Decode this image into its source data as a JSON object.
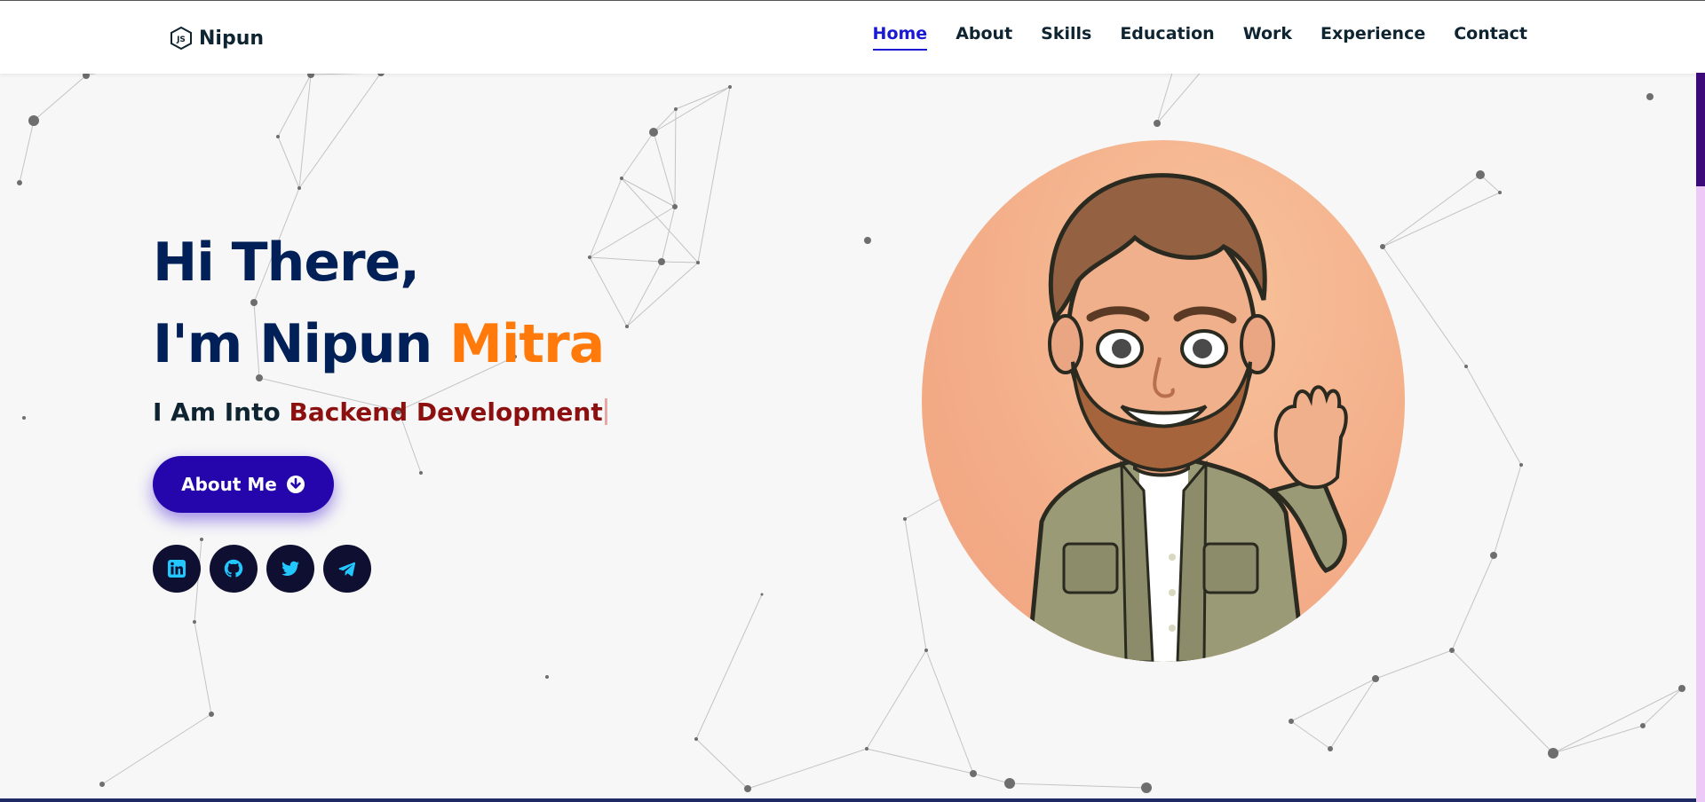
{
  "header": {
    "brand": {
      "name": "Nipun",
      "icon": "nodejs-hex-icon"
    },
    "nav": [
      {
        "label": "Home",
        "active": true
      },
      {
        "label": "About",
        "active": false
      },
      {
        "label": "Skills",
        "active": false
      },
      {
        "label": "Education",
        "active": false
      },
      {
        "label": "Work",
        "active": false
      },
      {
        "label": "Experience",
        "active": false
      },
      {
        "label": "Contact",
        "active": false
      }
    ]
  },
  "hero": {
    "greeting": "Hi There,",
    "name_prefix": "I'm Nipun ",
    "name_accent": "Mitra",
    "typed_prefix": "I Am Into ",
    "typed_value": "Backend Development",
    "about_button": {
      "label": "About Me",
      "icon": "arrow-down-circle-icon"
    },
    "socials": [
      {
        "name": "linkedin",
        "icon": "linkedin-icon"
      },
      {
        "name": "github",
        "icon": "github-icon"
      },
      {
        "name": "twitter",
        "icon": "twitter-icon"
      },
      {
        "name": "telegram",
        "icon": "telegram-icon"
      }
    ],
    "avatar": {
      "icon": "cartoon-avatar-waving"
    }
  },
  "colors": {
    "nav_active": "#1a1ad4",
    "heading": "#002057",
    "accent_orange": "#ff7a0b",
    "typed_accent": "#8d1010",
    "button": "#2506ad",
    "social_bg": "#0e0f31",
    "social_icon": "#22c7ff"
  }
}
